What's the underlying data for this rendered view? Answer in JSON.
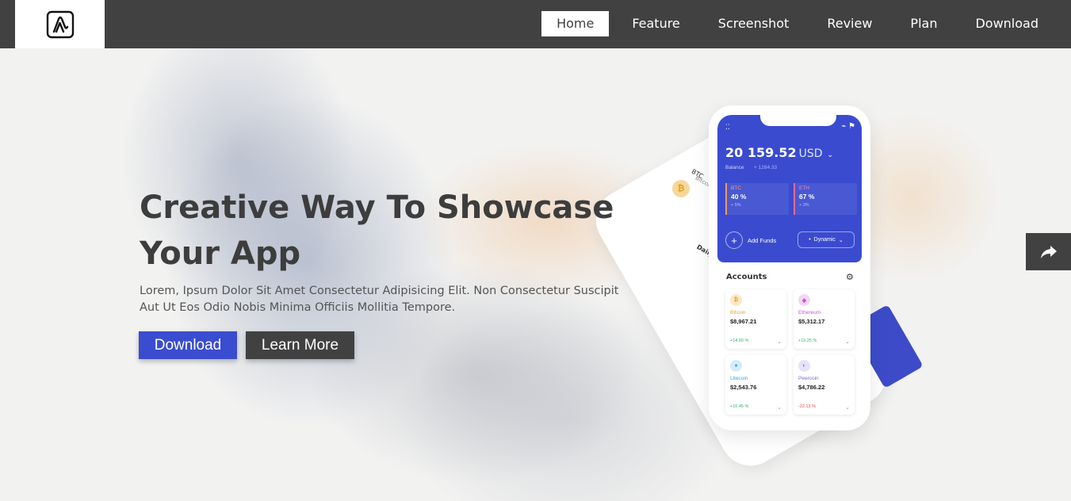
{
  "nav": {
    "items": [
      "Home",
      "Feature",
      "Screenshot",
      "Review",
      "Plan",
      "Download"
    ],
    "active": "Home"
  },
  "hero": {
    "title_line1": "Creative Way To Showcase",
    "title_line2": "Your App",
    "description": "Lorem, Ipsum Dolor Sit Amet Consectetur Adipisicing Elit. Non Consectetur Suscipit Aut Ut Eos Odio Nobis Minima Officiis Mollitia Tempore.",
    "download_label": "Download",
    "learn_more_label": "Learn More"
  },
  "phone": {
    "balance": "20 159.52",
    "currency": "USD",
    "balance_label": "Balance",
    "balance_delta": "+ 1284.33",
    "btc": {
      "label": "BTC",
      "value": "40 %",
      "sub": "+ 5%"
    },
    "eth": {
      "label": "ETH",
      "value": "67 %",
      "sub": "+ 3%"
    },
    "add_funds": "Add Funds",
    "dynamic": "Dynamic",
    "accounts_title": "Accounts",
    "accounts": [
      {
        "name": "Bitcoin",
        "value": "$8,967.21",
        "change": "+14.50 %"
      },
      {
        "name": "Ethereum",
        "value": "$5,312.17",
        "change": "+19.25 %"
      },
      {
        "name": "Litecoin",
        "value": "$2,543.76",
        "change": "+10.45 %"
      },
      {
        "name": "Peercoin",
        "value": "$4,786.22",
        "change": "-22.13 %"
      }
    ],
    "back_phone": {
      "line1": "BTC",
      "line2": "Bitcoin",
      "line3": "Daily"
    }
  },
  "colors": {
    "nav_bg": "#414141",
    "primary": "#3a4dd0",
    "dark": "#414141"
  },
  "icons": {
    "logo": "logo-icon",
    "share": "share-arrow-icon"
  }
}
